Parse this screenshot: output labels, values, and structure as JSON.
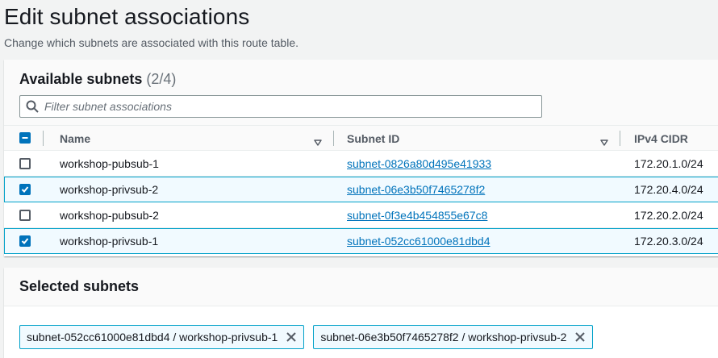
{
  "header": {
    "title": "Edit subnet associations",
    "description": "Change which subnets are associated with this route table."
  },
  "available": {
    "title": "Available subnets",
    "count": "(2/4)",
    "filter": {
      "placeholder": "Filter subnet associations",
      "value": ""
    },
    "columns": {
      "name": "Name",
      "subnet_id": "Subnet ID",
      "cidr": "IPv4 CIDR"
    },
    "rows": [
      {
        "checked": false,
        "name": "workshop-pubsub-1",
        "subnet_id": "subnet-0826a80d495e41933",
        "cidr": "172.20.1.0/24"
      },
      {
        "checked": true,
        "name": "workshop-privsub-2",
        "subnet_id": "subnet-06e3b50f7465278f2",
        "cidr": "172.20.4.0/24"
      },
      {
        "checked": false,
        "name": "workshop-pubsub-2",
        "subnet_id": "subnet-0f3e4b454855e67c8",
        "cidr": "172.20.2.0/24"
      },
      {
        "checked": true,
        "name": "workshop-privsub-1",
        "subnet_id": "subnet-052cc61000e81dbd4",
        "cidr": "172.20.3.0/24"
      }
    ]
  },
  "selected": {
    "title": "Selected subnets",
    "tokens": [
      {
        "label": "subnet-052cc61000e81dbd4 / workshop-privsub-1"
      },
      {
        "label": "subnet-06e3b50f7465278f2 / workshop-privsub-2"
      }
    ]
  },
  "colors": {
    "accent": "#0073bb",
    "selected_bg": "#f1faff",
    "selected_border": "#00a1c9"
  }
}
